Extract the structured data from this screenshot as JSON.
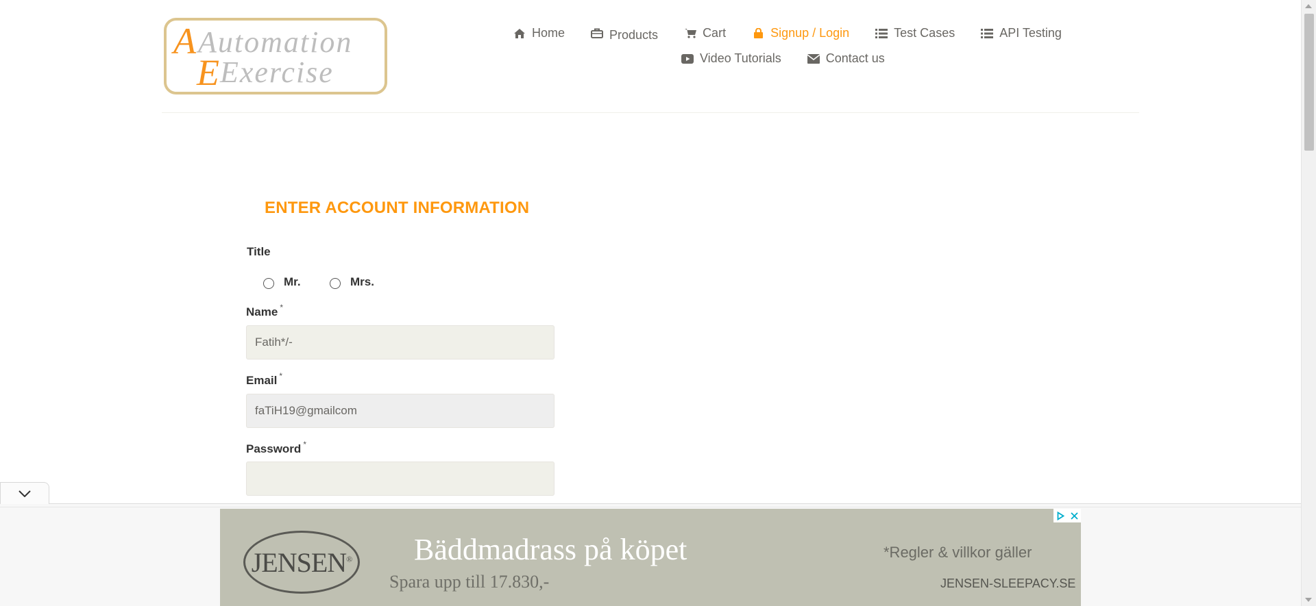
{
  "logo": {
    "line1": "Automation",
    "line2": "Exercise"
  },
  "nav": {
    "row1": [
      {
        "label": "Home",
        "icon": "home-icon"
      },
      {
        "label": "Products",
        "icon": "briefcase-icon"
      },
      {
        "label": "Cart",
        "icon": "cart-icon"
      },
      {
        "label": "Signup / Login",
        "icon": "lock-icon",
        "active": true
      },
      {
        "label": "Test Cases",
        "icon": "list-icon"
      },
      {
        "label": "API Testing",
        "icon": "list-icon"
      }
    ],
    "row2": [
      {
        "label": "Video Tutorials",
        "icon": "youtube-icon"
      },
      {
        "label": "Contact us",
        "icon": "envelope-icon"
      }
    ]
  },
  "form": {
    "heading": "ENTER ACCOUNT INFORMATION",
    "title_label": "Title",
    "title_options": [
      "Mr.",
      "Mrs."
    ],
    "name_label": "Name",
    "name_value": "Fatih*/-",
    "email_label": "Email",
    "email_value": "faTiH19@gmailcom",
    "password_label": "Password",
    "password_value": "",
    "required_mark": "*"
  },
  "ad": {
    "brand": "JENSEN",
    "brand_mark": "®",
    "headline": "Bäddmadrass på köpet",
    "subline": "Spara upp till 17.830,-",
    "terms": "*Regler & villkor gäller",
    "url": "JENSEN-SLEEPACY.SE"
  },
  "colors": {
    "accent": "#fe980f",
    "nav_text": "#696763",
    "input_bg": "#f0f0e9",
    "ad_bg": "#bfc0b2"
  }
}
